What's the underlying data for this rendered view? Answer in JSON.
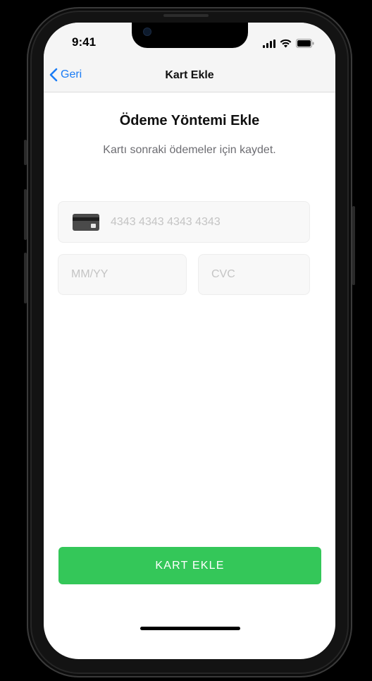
{
  "status_bar": {
    "time": "9:41"
  },
  "nav": {
    "back_label": "Geri",
    "title": "Kart Ekle"
  },
  "content": {
    "heading": "Ödeme Yöntemi Ekle",
    "subheading": "Kartı sonraki ödemeler için kaydet."
  },
  "form": {
    "card_number_placeholder": "4343 4343 4343 4343",
    "card_number_value": "",
    "expiry_placeholder": "MM/YY",
    "expiry_value": "",
    "cvc_placeholder": "CVC",
    "cvc_value": ""
  },
  "submit": {
    "label": "KART EKLE"
  },
  "icons": {
    "back": "chevron-left-icon",
    "card": "credit-card-icon",
    "signal": "cellular-signal-icon",
    "wifi": "wifi-icon",
    "battery": "battery-icon"
  },
  "colors": {
    "accent": "#1a7cf5",
    "primary_button": "#34c759",
    "nav_background": "#f5f5f5",
    "placeholder": "#c4c4c4",
    "subtitle": "#6d6d72"
  }
}
